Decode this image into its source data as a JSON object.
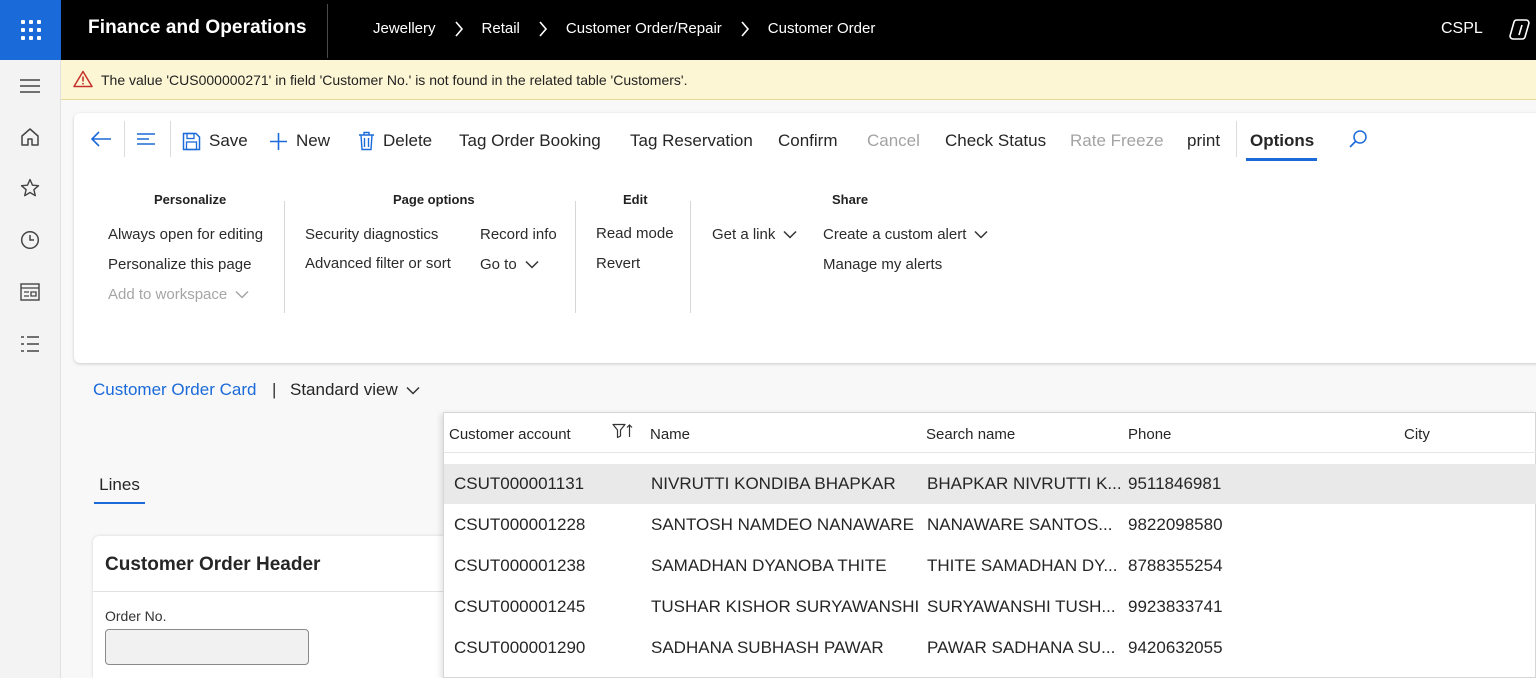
{
  "app": {
    "title": "Finance and Operations",
    "company": "CSPL"
  },
  "breadcrumb": [
    "Jewellery",
    "Retail",
    "Customer Order/Repair",
    "Customer Order"
  ],
  "message": {
    "text": "The value 'CUS000000271' in field 'Customer No.' is not found in the related table 'Customers'.",
    "type": "warning"
  },
  "toolbar": {
    "save": "Save",
    "new": "New",
    "delete": "Delete",
    "tag_order_booking": "Tag Order Booking",
    "tag_reservation": "Tag Reservation",
    "confirm": "Confirm",
    "cancel": "Cancel",
    "check_status": "Check Status",
    "rate_freeze": "Rate Freeze",
    "print": "print",
    "options": "Options"
  },
  "options_groups": {
    "personalize": {
      "title": "Personalize",
      "always_open": "Always open for editing",
      "personalize_page": "Personalize this page",
      "add_workspace": "Add to workspace"
    },
    "page_options": {
      "title": "Page options",
      "security": "Security diagnostics",
      "advanced_filter": "Advanced filter or sort",
      "record_info": "Record info",
      "go_to": "Go to"
    },
    "edit": {
      "title": "Edit",
      "read_mode": "Read mode",
      "revert": "Revert"
    },
    "share": {
      "title": "Share",
      "get_link": "Get a link",
      "custom_alert": "Create a custom alert",
      "manage_alerts": "Manage my alerts"
    }
  },
  "page": {
    "form_name": "Customer Order Card",
    "separator": "|",
    "view": "Standard view",
    "tab": "Lines",
    "header_title": "Customer Order Header",
    "order_no_label": "Order No.",
    "order_no_value": ""
  },
  "lookup": {
    "columns": [
      "Customer account",
      "Name",
      "Search name",
      "Phone",
      "City"
    ],
    "rows": [
      {
        "account": "CSUT000001131",
        "name": "NIVRUTTI KONDIBA BHAPKAR",
        "search": "BHAPKAR NIVRUTTI K...",
        "phone": "9511846981",
        "city": "",
        "selected": true
      },
      {
        "account": "CSUT000001228",
        "name": "SANTOSH NAMDEO NANAWARE",
        "search": "NANAWARE SANTOS...",
        "phone": "9822098580",
        "city": ""
      },
      {
        "account": "CSUT000001238",
        "name": "SAMADHAN DYANOBA THITE",
        "search": "THITE SAMADHAN DY...",
        "phone": "8788355254",
        "city": ""
      },
      {
        "account": "CSUT000001245",
        "name": "TUSHAR KISHOR SURYAWANSHI",
        "search": "SURYAWANSHI TUSH...",
        "phone": "9923833741",
        "city": ""
      },
      {
        "account": "CSUT000001290",
        "name": "SADHANA SUBHASH PAWAR",
        "search": "PAWAR SADHANA SU...",
        "phone": "9420632055",
        "city": ""
      }
    ]
  },
  "colors": {
    "accent": "#1b6ad9",
    "topbar": "#000000",
    "warning_bg": "#fdf6d4",
    "warning_icon": "#c4312b"
  }
}
